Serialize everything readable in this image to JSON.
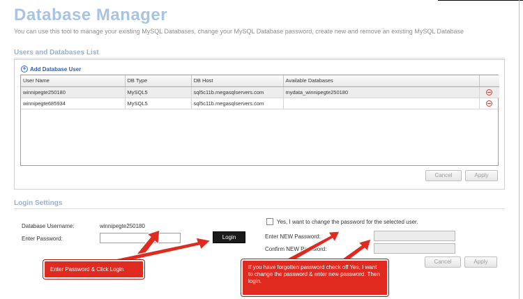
{
  "page": {
    "title": "Database Manager",
    "description": "You can use this tool to manage your existing MySQL Databases, change your MySQL Database password, create new and remove an existing MySQL Database"
  },
  "users_section": {
    "title": "Users and Databases List",
    "add_user_label": "Add Database User",
    "columns": [
      "User Name",
      "DB Type",
      "DB Host",
      "Available Databases",
      ""
    ],
    "rows": [
      {
        "user": "winnipegte250180",
        "type": "MySQL5",
        "host": "sql5c11b.megasqlservers.com",
        "databases": "mydata_winnipegte250180"
      },
      {
        "user": "winnipegte685934",
        "type": "MySQL5",
        "host": "sql5c11b.megasqlservers.com",
        "databases": ""
      }
    ],
    "cancel_label": "Cancel",
    "apply_label": "Apply"
  },
  "login_section": {
    "title": "Login Settings",
    "username_label": "Database Username:",
    "username_value": "winnipegte250180",
    "password_label": "Enter Password:",
    "login_label": "Login",
    "change_password_label": "Yes, I want to change the password for the selected user.",
    "new_password_label": "Enter NEW Password:",
    "confirm_password_label": "Confirm NEW Password:",
    "cancel_label": "Cancel",
    "apply_label": "Apply"
  },
  "callouts": {
    "login_hint": "Enter Password & Click Login",
    "forgot_hint": "If you have forgotten password check off Yes, I want to change the password & enter new password. Then login."
  },
  "colors": {
    "title": "#a9c3e3",
    "section_title": "#93b2d6",
    "callout": "#e02a20",
    "link": "#2a5db8",
    "delete": "#d23a3a"
  }
}
